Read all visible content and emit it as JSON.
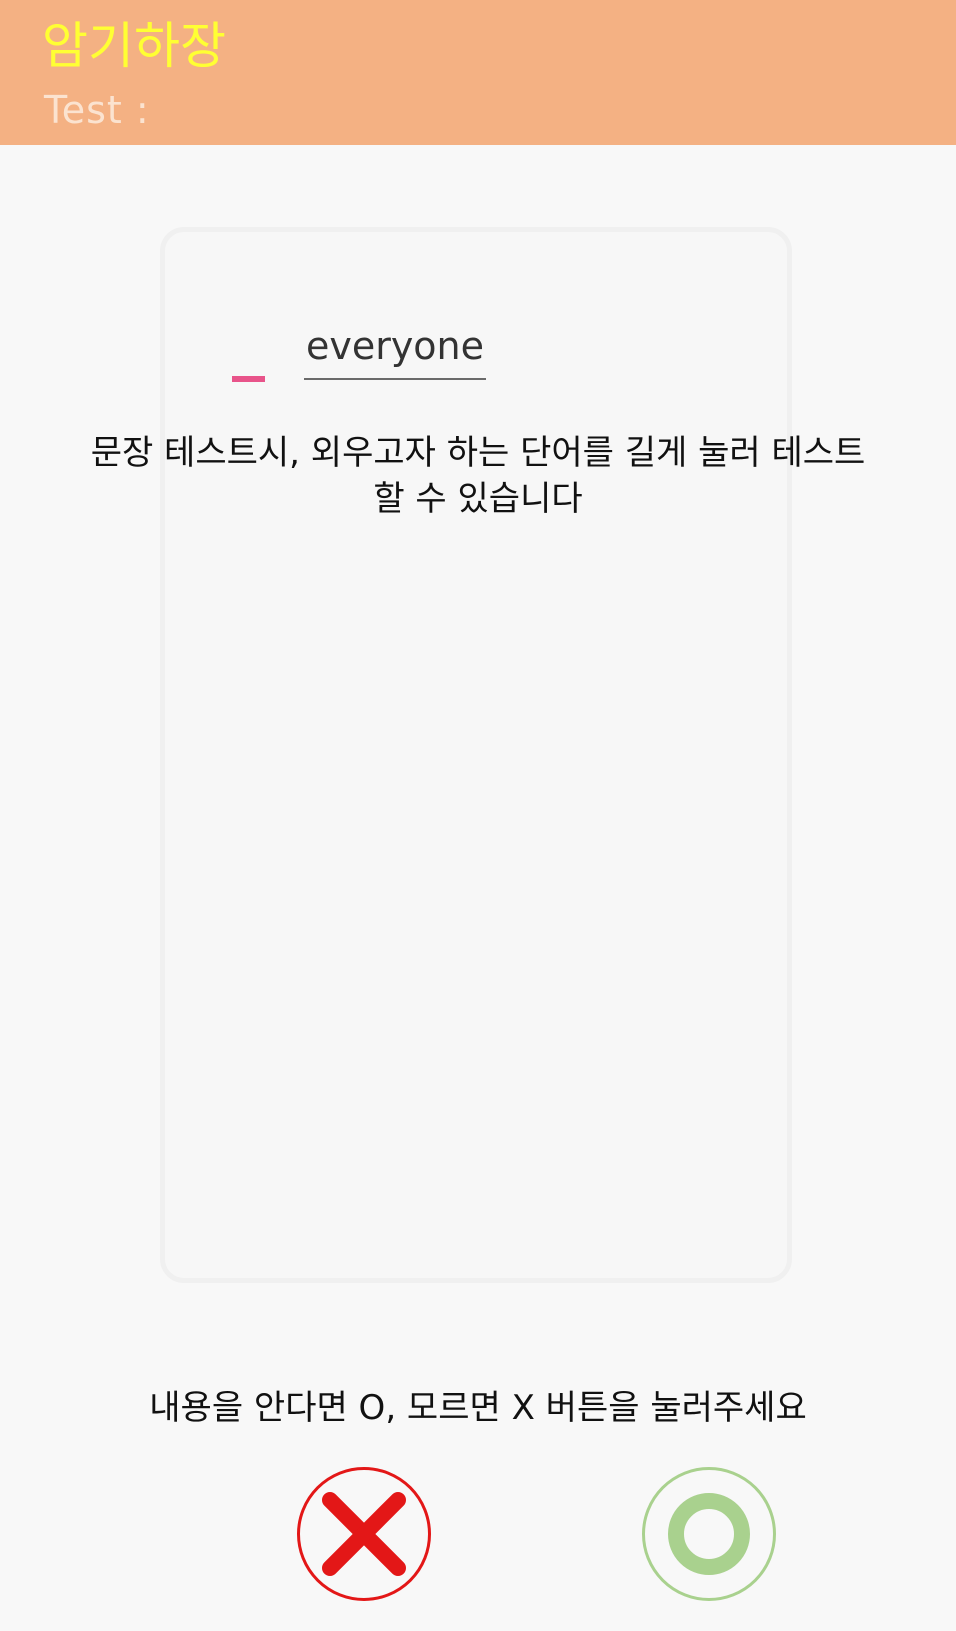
{
  "header": {
    "app_title": "암기하장",
    "test_label": "Test :"
  },
  "card": {
    "word": "everyone",
    "hint": "문장 테스트시, 외우고자 하는 단어를 길게 눌러 테스트할 수 있습니다"
  },
  "instruction": "내용을 안다면 O, 모르면 X 버튼을 눌러주세요",
  "buttons": {
    "dont_know_icon": "x-icon",
    "know_icon": "o-icon"
  },
  "colors": {
    "header_bg": "#f4b183",
    "title": "#ffff33",
    "x_red": "#e31717",
    "o_green": "#a9d18e",
    "accent_pink": "#e8548a"
  }
}
